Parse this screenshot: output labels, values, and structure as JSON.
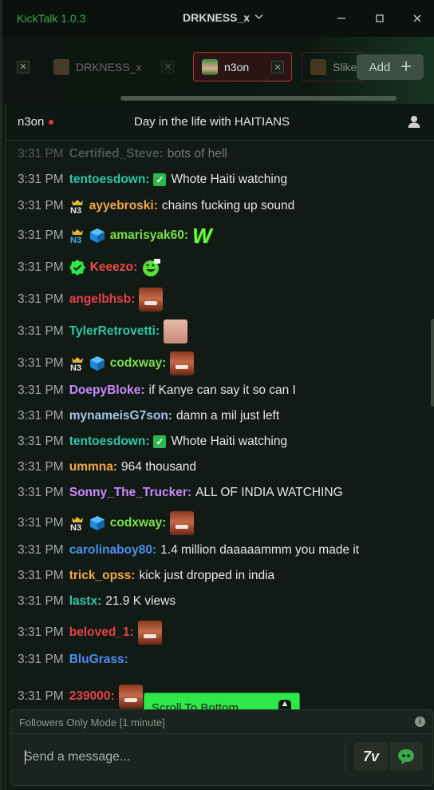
{
  "titlebar": {
    "app_title": "KickTalk 1.0.3",
    "user": "DRKNESS_x",
    "minimize_icon": "minimize-icon",
    "maximize_icon": "maximize-icon",
    "close_icon": "close-icon"
  },
  "tabs": {
    "items": [
      {
        "label": "DRKNESS_x",
        "active": false
      },
      {
        "label": "n3on",
        "active": true
      },
      {
        "label": "Sliker",
        "active": false
      }
    ],
    "add_label": "Add"
  },
  "chat": {
    "channel": "n3on",
    "stream_title": "Day in the life with HAITIANS",
    "messages": [
      {
        "time": "3:31 PM",
        "user": "Certified_Steve:",
        "text": "bots of hell"
      },
      {
        "time": "3:31 PM",
        "user": "tentoesdown:",
        "text": "Whote Haiti watching"
      },
      {
        "time": "3:31 PM",
        "user": "ayyebroski:",
        "text": "chains fucking up sound"
      },
      {
        "time": "3:31 PM",
        "user": "amarisyak60:",
        "text": ""
      },
      {
        "time": "3:31 PM",
        "user": "Keeezo:",
        "text": ""
      },
      {
        "time": "3:31 PM",
        "user": "angelbhsb:",
        "text": ""
      },
      {
        "time": "3:31 PM",
        "user": "TylerRetrovetti:",
        "text": ""
      },
      {
        "time": "3:31 PM",
        "user": "codxway:",
        "text": ""
      },
      {
        "time": "3:31 PM",
        "user": "DoepyBloke:",
        "text": "if Kanye can say it so can I"
      },
      {
        "time": "3:31 PM",
        "user": "mynameisG7son:",
        "text": "damn a mil just left"
      },
      {
        "time": "3:31 PM",
        "user": "tentoesdown:",
        "text": "Whote Haiti watching"
      },
      {
        "time": "3:31 PM",
        "user": "ummna:",
        "text": "964 thousand"
      },
      {
        "time": "3:31 PM",
        "user": "Sonny_The_Trucker:",
        "text": "ALL OF INDIA WATCHING"
      },
      {
        "time": "3:31 PM",
        "user": "codxway:",
        "text": ""
      },
      {
        "time": "3:31 PM",
        "user": "carolinaboy80:",
        "text": "1.4 million daaaaammm you made it"
      },
      {
        "time": "3:31 PM",
        "user": "trick_opss:",
        "text": "kick just dropped in india"
      },
      {
        "time": "3:31 PM",
        "user": "lastx:",
        "text": "21.9 K views"
      },
      {
        "time": "3:31 PM",
        "user": "beloved_1:",
        "text": ""
      },
      {
        "time": "3:31 PM",
        "user": "BluGrass:",
        "text": ""
      },
      {
        "time": "3:31 PM",
        "user": "239000:",
        "text": ""
      }
    ],
    "scroll_to_bottom": "Scroll To Bottom"
  },
  "input": {
    "mode": "Followers Only Mode [1 minute]",
    "placeholder": "Send a message...",
    "seventv_label": "7v"
  },
  "colors": {
    "accent_green": "#2ee84a",
    "live_red": "#e8343a",
    "active_tab_border": "#b4363a"
  }
}
